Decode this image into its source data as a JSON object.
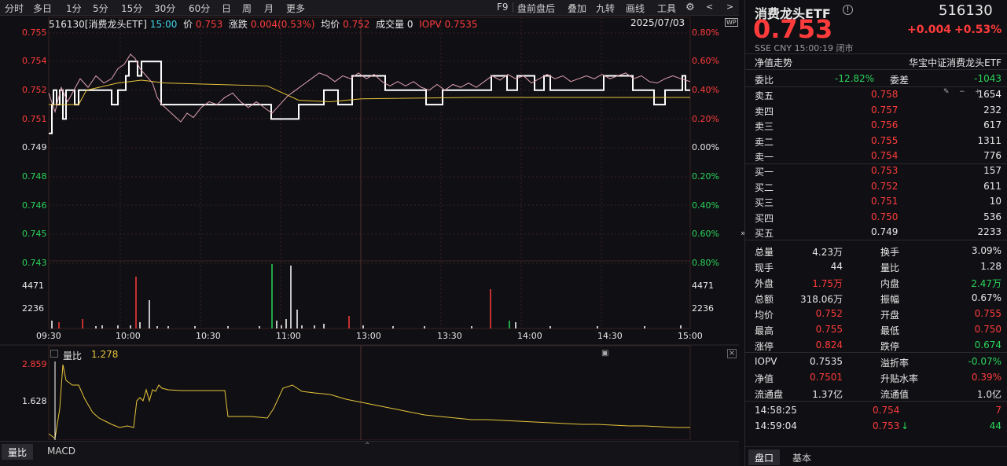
{
  "toolbar": {
    "items": [
      "分时",
      "多日",
      "1分",
      "5分",
      "15分",
      "30分",
      "60分",
      "日",
      "周",
      "月",
      "更多"
    ],
    "right_items": [
      "F9",
      "盘前盘后",
      "叠加",
      "九转",
      "画线",
      "工具"
    ]
  },
  "chart_header": {
    "code_name": "516130[消费龙头ETF]",
    "time": "15:00",
    "price_label": "价",
    "price": "0.753",
    "change_label": "涨跌",
    "change": "0.004(0.53%)",
    "avg_label": "均价",
    "avg": "0.752",
    "vol_label": "成交量",
    "vol": "0",
    "iopv_label": "IOPV",
    "iopv": "0.7535",
    "date": "2025/07/03",
    "badge": "WP"
  },
  "price_axis": {
    "left": [
      "0.755",
      "0.754",
      "0.752",
      "0.751",
      "0.749",
      "0.748",
      "0.746",
      "0.745",
      "0.743"
    ],
    "right": [
      "0.80%",
      "0.60%",
      "0.40%",
      "0.20%",
      "0.00%",
      "0.20%",
      "0.40%",
      "0.60%",
      "0.80%"
    ]
  },
  "vol_axis": {
    "left": [
      "4471",
      "2236"
    ],
    "right": [
      "4471",
      "2236"
    ]
  },
  "time_axis": [
    "09:30",
    "10:00",
    "10:30",
    "11:00",
    "13:00",
    "13:30",
    "14:00",
    "14:30",
    "15:00"
  ],
  "sub_chart": {
    "label": "量比",
    "value": "1.278",
    "y_ticks": [
      "2.859",
      "1.628"
    ]
  },
  "bottom_tabs": [
    "量比",
    "MACD"
  ],
  "quote": {
    "name": "消费龙头ETF",
    "code": "516130",
    "price": "0.753",
    "change": "+0.004",
    "pct": "+0.53%",
    "meta": [
      "SSE",
      "CNY",
      "15:00:19",
      "闭市"
    ],
    "nav_trend": "净值走势",
    "index": "华宝中证消费龙头ETF",
    "weibi_label": "委比",
    "weibi": "-12.82%",
    "weicha_label": "委差",
    "weicha": "-1043",
    "asks": [
      {
        "label": "卖五",
        "price": "0.758",
        "vol": "1654"
      },
      {
        "label": "卖四",
        "price": "0.757",
        "vol": "232"
      },
      {
        "label": "卖三",
        "price": "0.756",
        "vol": "617"
      },
      {
        "label": "卖二",
        "price": "0.755",
        "vol": "1311"
      },
      {
        "label": "卖一",
        "price": "0.754",
        "vol": "776"
      }
    ],
    "bids": [
      {
        "label": "买一",
        "price": "0.753",
        "vol": "157"
      },
      {
        "label": "买二",
        "price": "0.752",
        "vol": "611"
      },
      {
        "label": "买三",
        "price": "0.751",
        "vol": "10"
      },
      {
        "label": "买四",
        "price": "0.750",
        "vol": "536"
      },
      {
        "label": "买五",
        "price": "0.749",
        "vol": "2233"
      }
    ],
    "stats": [
      [
        "总量",
        "4.23万",
        "换手",
        "3.09%"
      ],
      [
        "现手",
        "44",
        "量比",
        "1.28"
      ],
      [
        "外盘",
        "1.75万",
        "内盘",
        "2.47万"
      ],
      [
        "总额",
        "318.06万",
        "振幅",
        "0.67%"
      ],
      [
        "均价",
        "0.752",
        "开盘",
        "0.755"
      ],
      [
        "最高",
        "0.755",
        "最低",
        "0.750"
      ],
      [
        "涨停",
        "0.824",
        "跌停",
        "0.674"
      ]
    ],
    "stats2": [
      [
        "IOPV",
        "0.7535",
        "溢折率",
        "-0.07%"
      ],
      [
        "净值",
        "0.7501",
        "升贴水率",
        "0.39%"
      ],
      [
        "流通盘",
        "1.37亿",
        "流通值",
        "1.0亿"
      ]
    ],
    "ticks": [
      {
        "time": "14:58:25",
        "price": "0.754",
        "vol": "7"
      },
      {
        "time": "14:59:04",
        "price": "0.753",
        "vol": "44"
      }
    ],
    "tabs": [
      "盘口",
      "基本"
    ]
  },
  "colors": {
    "up": "#ff3b3b",
    "down": "#2bd45a",
    "avg": "#e8c43a",
    "price_line": "#ffffff",
    "pct_line": "#e0a0b0"
  }
}
